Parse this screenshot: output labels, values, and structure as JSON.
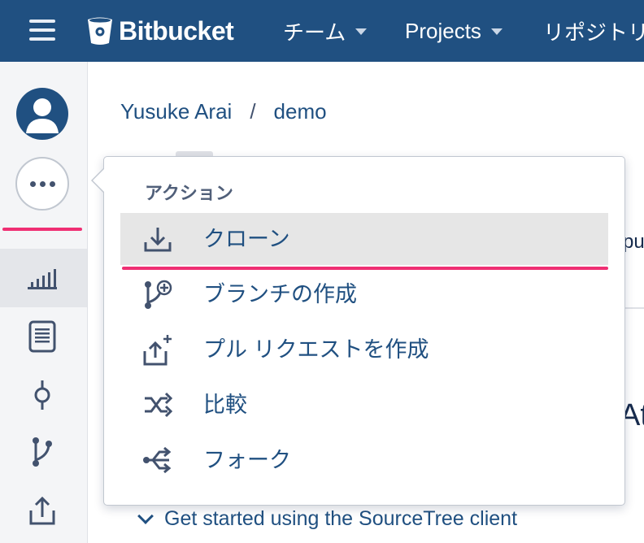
{
  "topbar": {
    "brand": "Bitbucket",
    "nav": [
      {
        "label": "チーム"
      },
      {
        "label": "Projects"
      },
      {
        "label": "リポジトリ"
      }
    ]
  },
  "breadcrumb": {
    "owner": "Yusuke Arai",
    "separator": "/",
    "repo": "demo"
  },
  "dropdown": {
    "heading": "アクション",
    "items": [
      {
        "label": "クローン",
        "icon": "download-icon"
      },
      {
        "label": "ブランチの作成",
        "icon": "create-branch-icon"
      },
      {
        "label": "プル リクエストを作成",
        "icon": "create-pull-request-icon"
      },
      {
        "label": "比較",
        "icon": "compare-icon"
      },
      {
        "label": "フォーク",
        "icon": "fork-icon"
      }
    ]
  },
  "main": {
    "peek_right_top": "pu",
    "peek_right_mid": "At",
    "get_started": "Get started using the SourceTree client"
  },
  "colors": {
    "topbar": "#205081",
    "link": "#205081",
    "highlight": "#ef2f73",
    "active_row": "#e6e6e6"
  }
}
